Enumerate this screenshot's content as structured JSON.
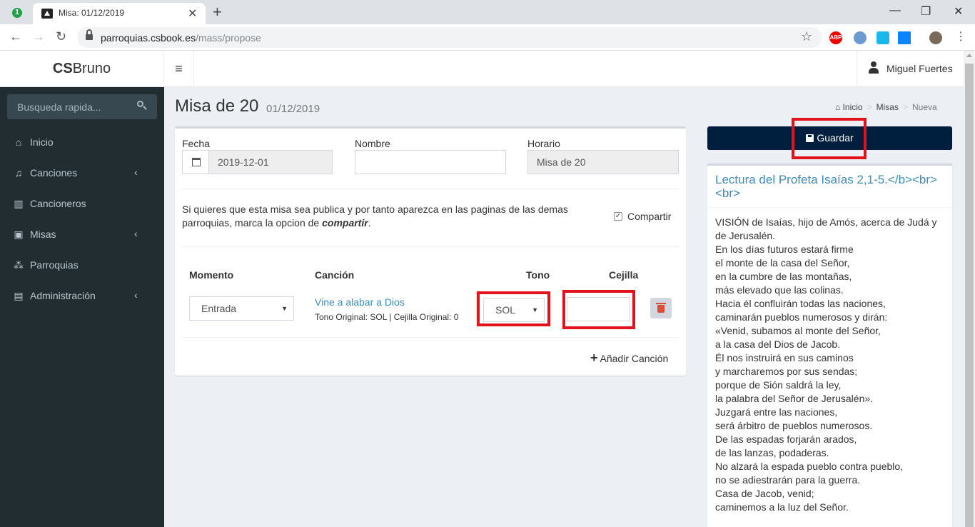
{
  "browser": {
    "tab_counter": "1",
    "tab_title": "Misa: 01/12/2019",
    "url_host": "parroquias.csbook.es",
    "url_path": "/mass/propose",
    "extensions": [
      "abp-icon",
      "ff-icon",
      "v-icon",
      "windows-icon",
      "profile-avatar"
    ],
    "ext_abp": "ABP"
  },
  "header": {
    "logo_bold": "CS",
    "logo_rest": "Bruno",
    "user_name": "Miguel Fuertes"
  },
  "sidebar": {
    "search_placeholder": "Busqueda rapida...",
    "items": [
      {
        "label": "Inicio",
        "icon": "home-icon",
        "has_children": false
      },
      {
        "label": "Canciones",
        "icon": "music-icon",
        "has_children": true
      },
      {
        "label": "Cancioneros",
        "icon": "book-icon",
        "has_children": false
      },
      {
        "label": "Misas",
        "icon": "calendar-plus-icon",
        "has_children": true
      },
      {
        "label": "Parroquias",
        "icon": "sitemap-icon",
        "has_children": false
      },
      {
        "label": "Administración",
        "icon": "briefcase-icon",
        "has_children": true
      }
    ]
  },
  "page": {
    "title": "Misa de 20",
    "subtitle": "01/12/2019",
    "breadcrumb": [
      "Inicio",
      "Misas",
      "Nueva"
    ]
  },
  "form": {
    "fecha_label": "Fecha",
    "fecha_value": "2019-12-01",
    "nombre_label": "Nombre",
    "nombre_value": "",
    "horario_label": "Horario",
    "horario_value": "Misa de 20",
    "info_text_1": "Si quieres que esta misa sea publica y por tanto aparezca en las paginas de las demas parroquias, marca la opcion de ",
    "info_text_em": "compartir",
    "info_text_2": ".",
    "share_label": "Compartir",
    "share_checked": true
  },
  "songs": {
    "columns": [
      "Momento",
      "Canción",
      "Tono",
      "Cejilla"
    ],
    "rows": [
      {
        "momento": "Entrada",
        "cancion": "Vine a alabar a Dios",
        "meta": "Tono Original: SOL | Cejilla Original: 0",
        "tono": "SOL",
        "cejilla": ""
      }
    ],
    "add_label": "Añadir Canción"
  },
  "actions": {
    "save_label": "Guardar"
  },
  "reading": {
    "title": "Lectura del Profeta Isaías 2,1-5.</b><br><br>",
    "lines": [
      "VISIÓN de Isaías, hijo de Amós, acerca de Judá y",
      "de Jerusalén.",
      "En los días futuros estará firme",
      "el monte de la casa del Señor,",
      "en la cumbre de las montañas,",
      "más elevado que las colinas.",
      "Hacia él confluirán todas las naciones,",
      "caminarán pueblos numerosos y dirán:",
      "«Venid, subamos al monte del Señor,",
      "a la casa del Dios de Jacob.",
      "Él nos instruirá en sus caminos",
      "y marcharemos por sus sendas;",
      "porque de Sión saldrá la ley,",
      "la palabra del Señor de Jerusalén».",
      "Juzgará entre las naciones,",
      "será árbitro de pueblos numerosos.",
      "De las espadas forjarán arados,",
      "de las lanzas, podaderas.",
      "No alzará la espada pueblo contra pueblo,",
      "no se adiestrarán para la guerra.",
      "Casa de Jacob, venid;",
      "caminemos a la luz del Señor."
    ]
  },
  "colors": {
    "sidebar_bg": "#222d32",
    "primary_dark": "#001f3f",
    "link": "#3c8dbc",
    "highlight": "#e3111b"
  }
}
